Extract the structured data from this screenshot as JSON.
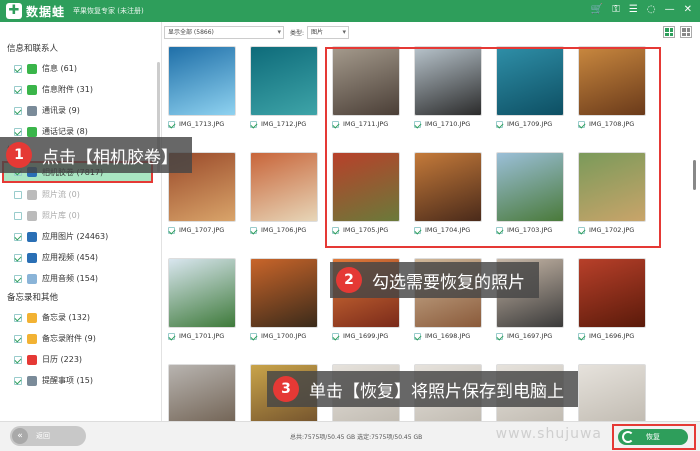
{
  "app": {
    "title": "数据蛙",
    "subtitle": "苹果恢复专家 (未注册)"
  },
  "sidebar": {
    "categories": [
      {
        "label": "信息和联系人",
        "items": [
          {
            "label": "信息 (61)",
            "checked": true,
            "icon_color": "#3ab54a"
          },
          {
            "label": "信息附件 (31)",
            "checked": true,
            "icon_color": "#3ab54a"
          },
          {
            "label": "通讯录 (9)",
            "checked": true,
            "icon_color": "#7a8b99"
          },
          {
            "label": "通话记录 (8)",
            "checked": true,
            "icon_color": "#3ab54a"
          }
        ]
      },
      {
        "label": "媒体",
        "items": [
          {
            "label": "相机胶卷 (7817)",
            "checked": true,
            "icon_color": "#2a6fb5",
            "selected": true
          },
          {
            "label": "照片流 (0)",
            "checked": false,
            "icon_color": "#bbbbbb"
          },
          {
            "label": "照片库 (0)",
            "checked": false,
            "icon_color": "#bbbbbb"
          },
          {
            "label": "应用图片 (24463)",
            "checked": true,
            "icon_color": "#2a6fb5"
          },
          {
            "label": "应用视频 (454)",
            "checked": true,
            "icon_color": "#2a6fb5"
          },
          {
            "label": "应用音频 (154)",
            "checked": true,
            "icon_color": "#8ab4d8"
          }
        ]
      },
      {
        "label": "备忘录和其他",
        "items": [
          {
            "label": "备忘录 (132)",
            "checked": true,
            "icon_color": "#f2b233"
          },
          {
            "label": "备忘录附件 (9)",
            "checked": true,
            "icon_color": "#f2b233"
          },
          {
            "label": "日历 (223)",
            "checked": true,
            "icon_color": "#e53935"
          },
          {
            "label": "提醒事项 (15)",
            "checked": true,
            "icon_color": "#7a8b99"
          }
        ]
      }
    ]
  },
  "filter": {
    "show_select": "显示全部 (5866)",
    "type_label": "类型:",
    "type_select": "图片"
  },
  "photos": [
    {
      "name": "IMG_1713.JPG",
      "checked": true,
      "colors": [
        "#1f6fa8",
        "#8fd2f0"
      ]
    },
    {
      "name": "IMG_1712.JPG",
      "checked": true,
      "colors": [
        "#0e6b7a",
        "#3ea4a8"
      ]
    },
    {
      "name": "IMG_1711.JPG",
      "checked": true,
      "colors": [
        "#a59b8d",
        "#4a3e36"
      ]
    },
    {
      "name": "IMG_1710.JPG",
      "checked": true,
      "colors": [
        "#b8c4cc",
        "#2b2b2b"
      ]
    },
    {
      "name": "IMG_1709.JPG",
      "checked": true,
      "colors": [
        "#2f8fa8",
        "#0d4f63"
      ]
    },
    {
      "name": "IMG_1708.JPG",
      "checked": true,
      "colors": [
        "#c9883f",
        "#6a3a1a"
      ]
    },
    {
      "name": "IMG_1707.JPG",
      "checked": true,
      "colors": [
        "#9a4a2a",
        "#d9a46a"
      ]
    },
    {
      "name": "IMG_1706.JPG",
      "checked": true,
      "colors": [
        "#c8653a",
        "#e7d6b8"
      ]
    },
    {
      "name": "IMG_1705.JPG",
      "checked": true,
      "colors": [
        "#b8402a",
        "#6a7a3a"
      ]
    },
    {
      "name": "IMG_1704.JPG",
      "checked": true,
      "colors": [
        "#c47a3a",
        "#4a2a1a"
      ]
    },
    {
      "name": "IMG_1703.JPG",
      "checked": true,
      "colors": [
        "#9bbfd8",
        "#4a7a3a"
      ]
    },
    {
      "name": "IMG_1702.JPG",
      "checked": true,
      "colors": [
        "#7a9a5a",
        "#c9a46a"
      ]
    },
    {
      "name": "IMG_1701.JPG",
      "checked": true,
      "colors": [
        "#d9e6ef",
        "#3e7a3a"
      ]
    },
    {
      "name": "IMG_1700.JPG",
      "checked": true,
      "colors": [
        "#c9652a",
        "#3a2a1a"
      ]
    },
    {
      "name": "IMG_1699.JPG",
      "checked": true,
      "colors": [
        "#e07a3a",
        "#7a2a1a"
      ]
    },
    {
      "name": "IMG_1698.JPG",
      "checked": true,
      "colors": [
        "#d0b89a",
        "#8a5a3a"
      ]
    },
    {
      "name": "IMG_1697.JPG",
      "checked": true,
      "colors": [
        "#c8b8a8",
        "#3a3a3a"
      ]
    },
    {
      "name": "IMG_1696.JPG",
      "checked": true,
      "colors": [
        "#b8402a",
        "#5a1a0a"
      ]
    },
    {
      "name": "",
      "checked": false,
      "colors": [
        "#b8b4b0",
        "#6a5a4a"
      ]
    },
    {
      "name": "",
      "checked": false,
      "colors": [
        "#c9a44a",
        "#6a4a2a"
      ]
    },
    {
      "name": "",
      "checked": false,
      "colors": [
        "#e6e2dc",
        "#bcb6ac"
      ]
    },
    {
      "name": "",
      "checked": false,
      "colors": [
        "#e6e2dc",
        "#bcb6ac"
      ]
    },
    {
      "name": "",
      "checked": false,
      "colors": [
        "#e6e2dc",
        "#bcb6ac"
      ]
    },
    {
      "name": "",
      "checked": false,
      "colors": [
        "#e6e2dc",
        "#bcb6ac"
      ]
    }
  ],
  "callouts": [
    {
      "num": "1",
      "text": "点击【相机胶卷】"
    },
    {
      "num": "2",
      "text": "勾选需要恢复的照片"
    },
    {
      "num": "3",
      "text": "单击【恢复】将照片保存到电脑上"
    }
  ],
  "bottom": {
    "back_label": "返回",
    "totals": "总共:7575项/50.45 GB  选定:7575项/50.45 GB",
    "watermark": "www.shujuwa",
    "restore_label": "恢复"
  },
  "colors": {
    "brand": "#2e9e5b",
    "highlight": "#e53935",
    "selected_bg": "#a9e6c2"
  }
}
